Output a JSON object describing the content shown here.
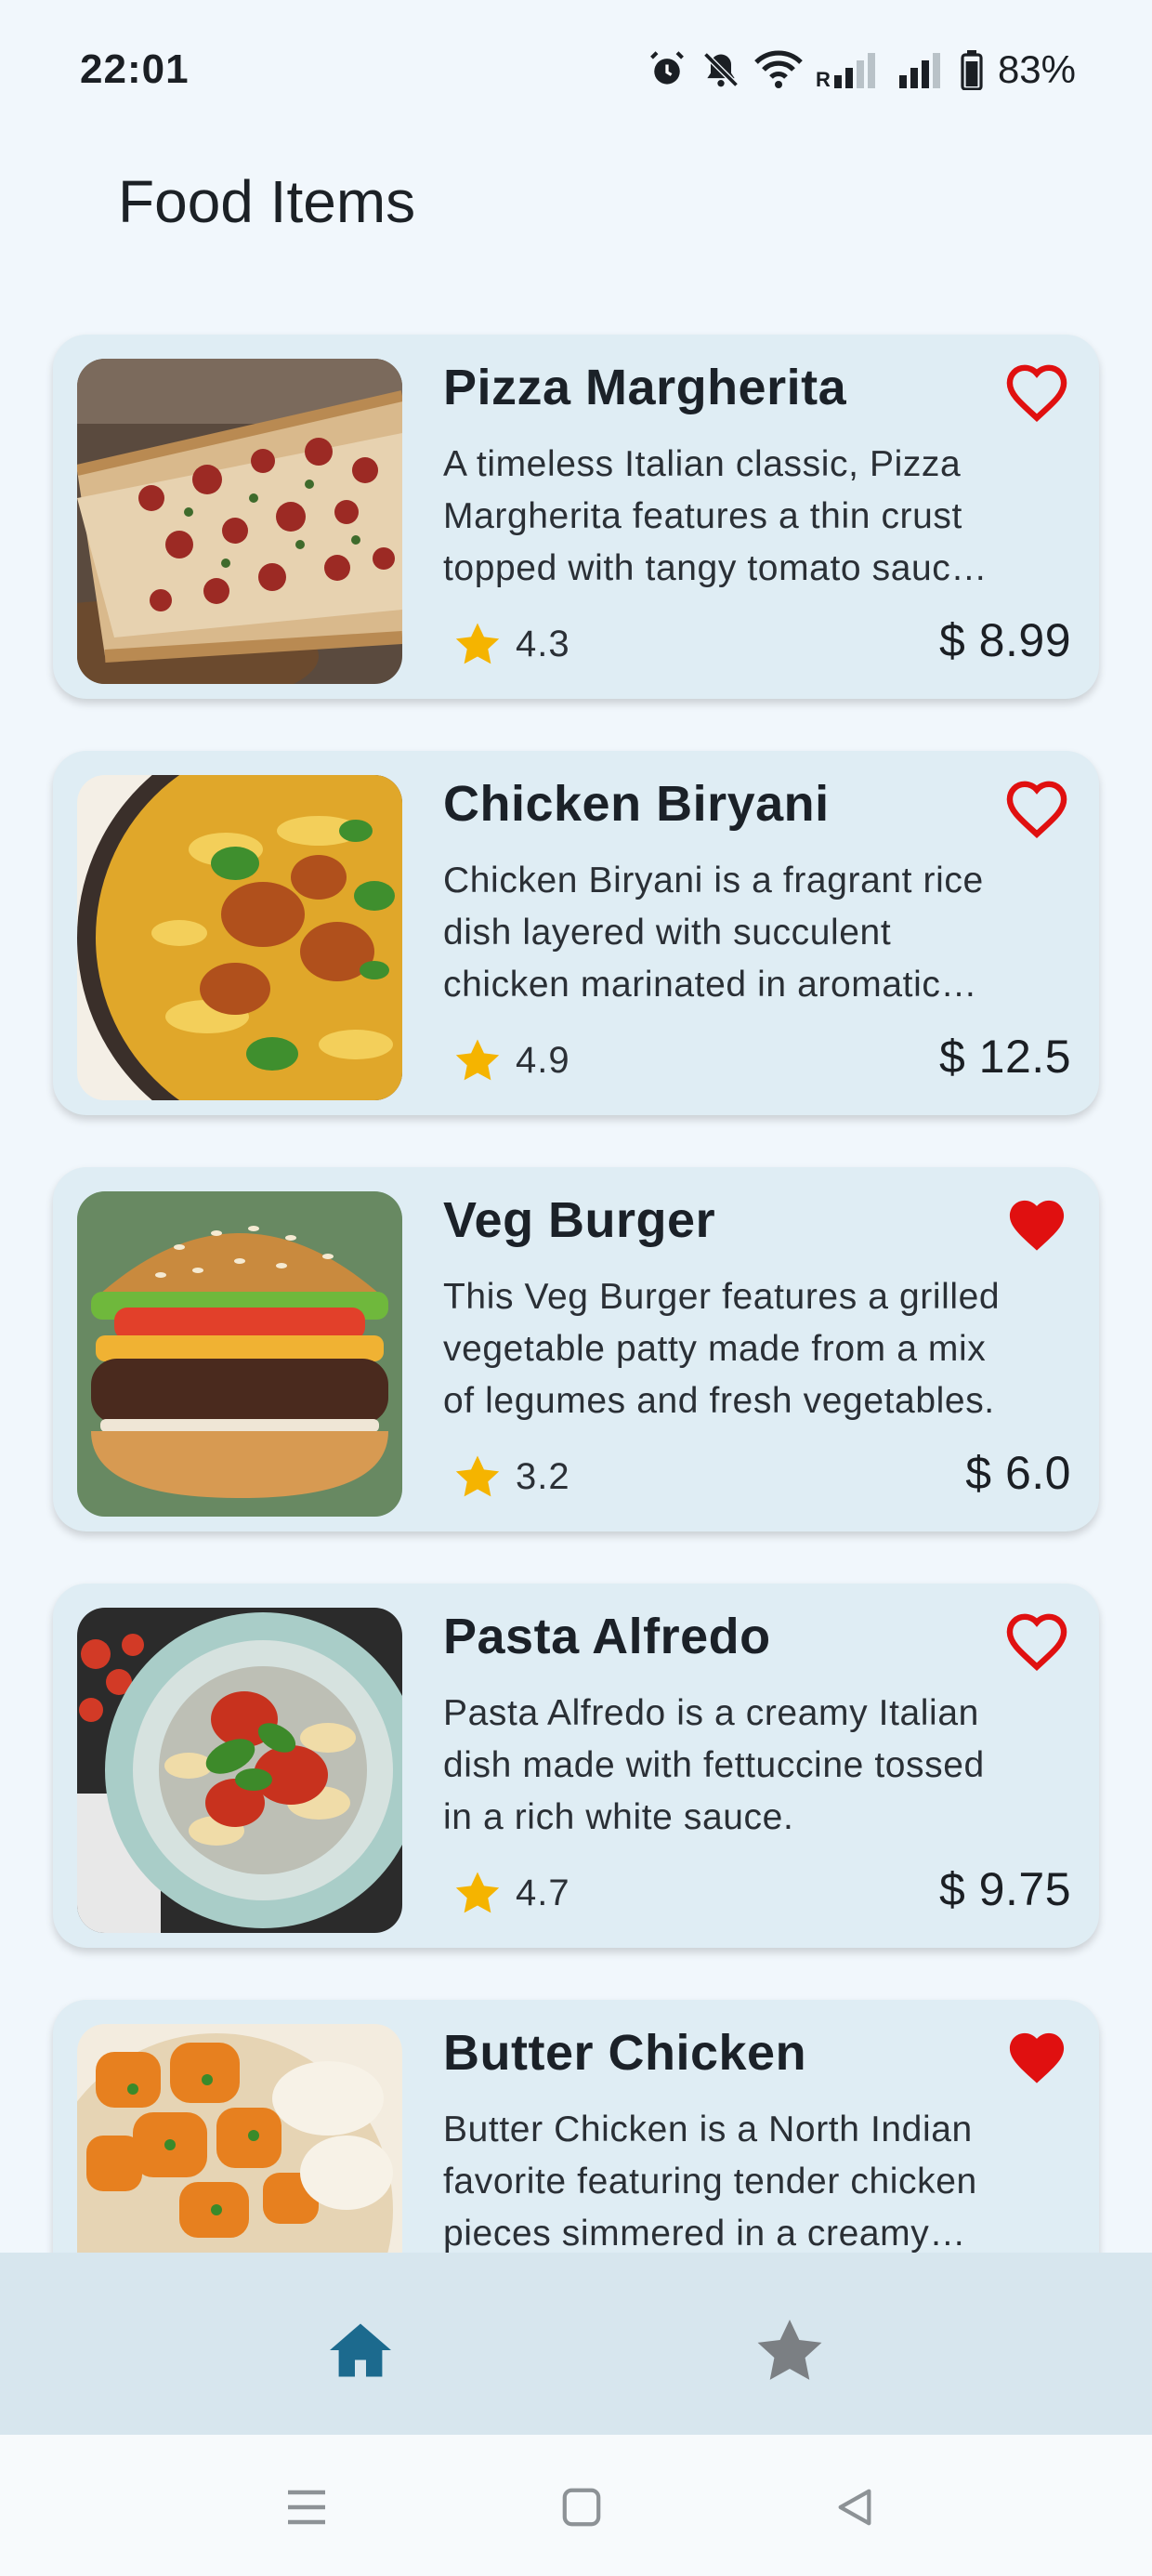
{
  "status_bar": {
    "time": "22:01",
    "battery": "83%",
    "icons": [
      "alarm-icon",
      "mute-icon",
      "wifi-icon",
      "signal-icon",
      "signal-icon",
      "battery-icon"
    ]
  },
  "page_title": "Food Items",
  "colors": {
    "accent": "#1c6a8e",
    "favorite": "#e01010",
    "star": "#f5b400",
    "card_bg": "#dfedf4",
    "nav_bg": "#d7e6ee"
  },
  "items": [
    {
      "name": "Pizza Margherita",
      "description": "A timeless Italian classic, Pizza Margherita features a thin crust topped with tangy tomato sauce, fresh mozzarella and basil.",
      "rating": "4.3",
      "price": "$ 8.99",
      "favorite": false,
      "image": "pizza-image"
    },
    {
      "name": "Chicken Biryani",
      "description": "Chicken Biryani is a fragrant rice dish layered with succulent chicken marinated in aromatic spices.",
      "rating": "4.9",
      "price": "$ 12.5",
      "favorite": false,
      "image": "biryani-image"
    },
    {
      "name": "Veg Burger",
      "description": "This Veg Burger features a grilled vegetable patty made from a mix of legumes and fresh vegetables.",
      "rating": "3.2",
      "price": "$ 6.0",
      "favorite": true,
      "image": "burger-image"
    },
    {
      "name": "Pasta Alfredo",
      "description": "Pasta Alfredo is a creamy Italian dish made with fettuccine tossed in a rich white sauce.",
      "rating": "4.7",
      "price": "$ 9.75",
      "favorite": false,
      "image": "pasta-image"
    },
    {
      "name": "Butter Chicken",
      "description": "Butter Chicken is a North Indian favorite featuring tender chicken pieces simmered in a creamy tomato gravy.",
      "rating": "",
      "price": "",
      "favorite": true,
      "image": "butter-chicken-image"
    }
  ],
  "bottom_nav": {
    "items": [
      {
        "icon": "home-icon",
        "selected": true
      },
      {
        "icon": "star-icon",
        "selected": false
      }
    ]
  },
  "system_nav": [
    "menu-icon",
    "home-square-icon",
    "back-icon"
  ]
}
